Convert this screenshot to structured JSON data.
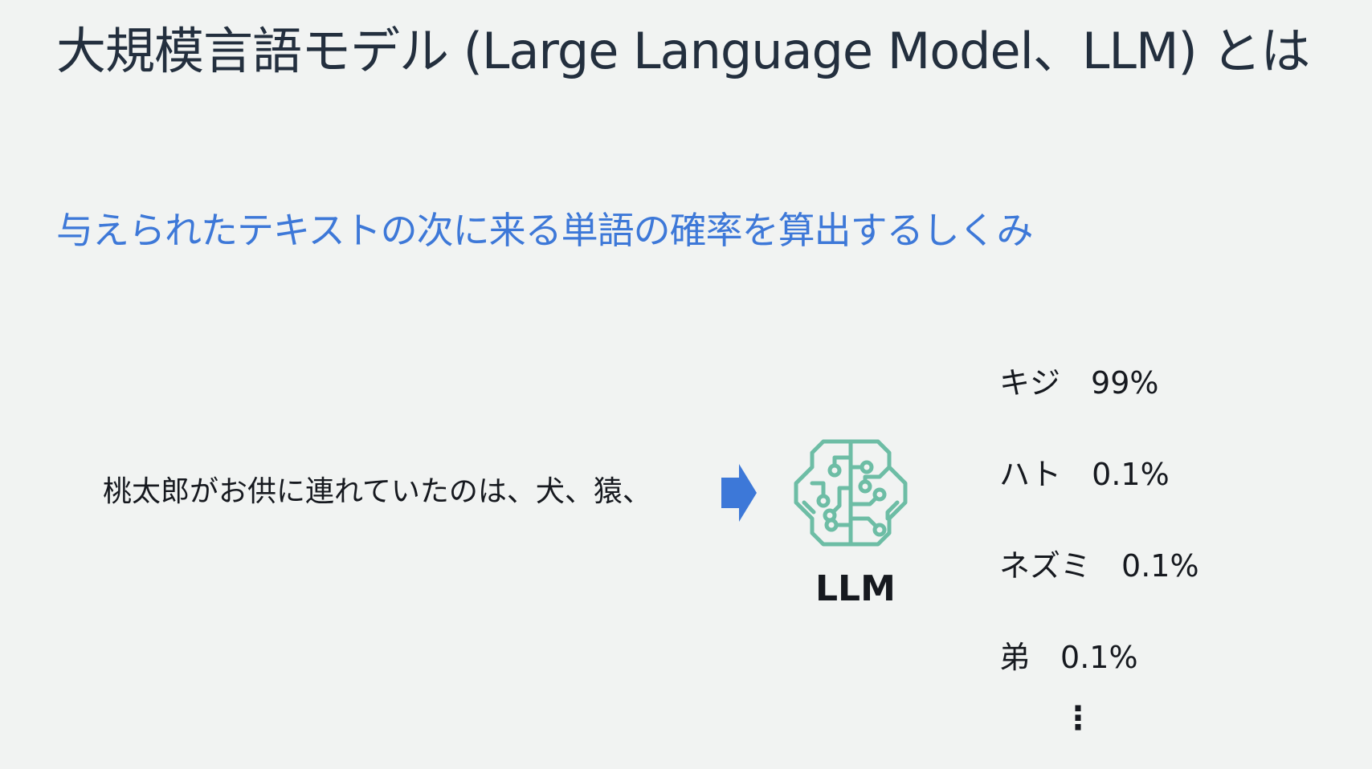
{
  "slide": {
    "title": "大規模言語モデル (Large Language Model、LLM) とは",
    "subtitle": "与えられたテキストの次に来る単語の確率を算出するしくみ",
    "prompt_text": "桃太郎がお供に連れていたのは、犬、猿、",
    "model_label": "LLM",
    "predictions": [
      {
        "word": "キジ",
        "probability": "99%"
      },
      {
        "word": "ハト",
        "probability": "0.1%"
      },
      {
        "word": "ネズミ",
        "probability": "0.1%"
      },
      {
        "word": "弟",
        "probability": "0.1%"
      }
    ],
    "more_indicator": "⋮"
  },
  "colors": {
    "background": "#f1f3f2",
    "title": "#232f3e",
    "subtitle": "#3d78d8",
    "arrow": "#3d78d8",
    "llm_icon": "#6dbda5"
  },
  "icons": {
    "arrow": "right-arrow-icon",
    "model": "brain-circuit-icon"
  }
}
